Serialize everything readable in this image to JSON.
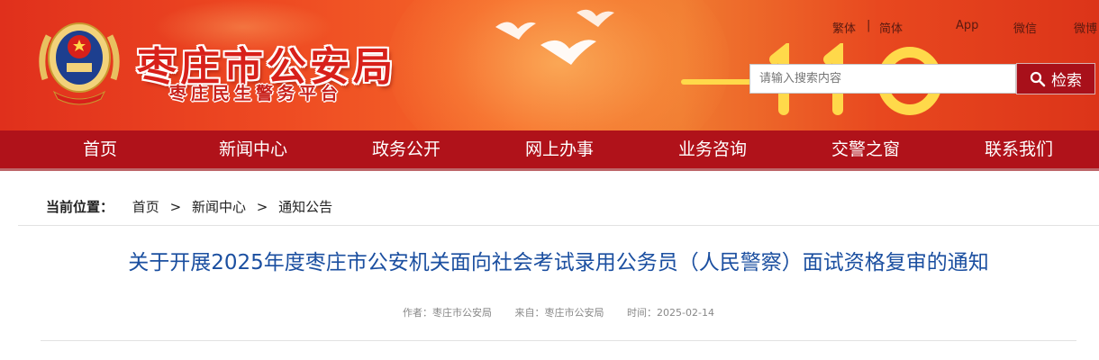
{
  "header": {
    "site_title": "枣庄市公安局",
    "site_subtitle": "枣庄民生警务平台",
    "top_links": [
      "繁体",
      "|",
      "简体",
      "App",
      "微信",
      "微博"
    ]
  },
  "search": {
    "placeholder": "请输入搜索内容",
    "button_label": "检索"
  },
  "nav": {
    "items": [
      "首页",
      "新闻中心",
      "政务公开",
      "网上办事",
      "业务咨询",
      "交警之窗",
      "联系我们"
    ]
  },
  "breadcrumb": {
    "label": "当前位置：",
    "items": [
      "首页",
      "新闻中心",
      "通知公告"
    ],
    "separator": ">"
  },
  "article": {
    "title": "关于开展2025年度枣庄市公安机关面向社会考试录用公务员（人民警察）面试资格复审的通知",
    "meta": {
      "author": "作者：枣庄市公安局",
      "source": "来自：枣庄市公安局",
      "time": "时间：2025-02-14"
    }
  },
  "colors": {
    "nav_bg": "#b0121a",
    "title_blue": "#1b4fa0",
    "brand_red": "#d8201a"
  }
}
